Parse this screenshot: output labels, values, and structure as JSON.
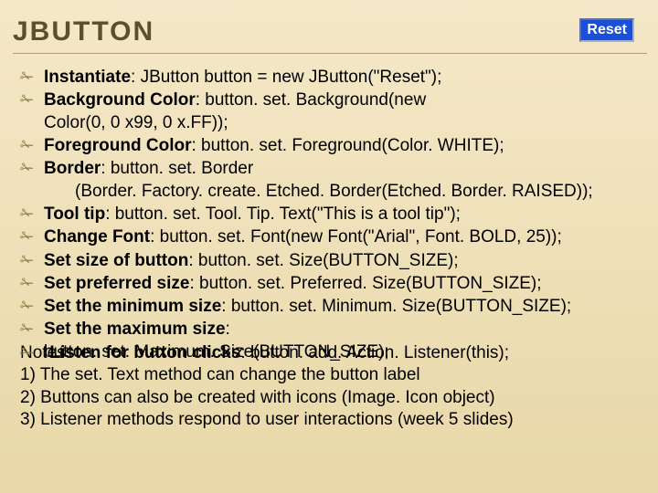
{
  "title": "JBUTTON",
  "button_label": "Reset",
  "items": [
    {
      "label": "Instantiate",
      "code": ": JButton button = new JButton(\"Reset\");"
    },
    {
      "label": "Background Color",
      "code": ": button. set. Background(new"
    },
    {
      "label_cont": "Color(0, 0 x99, 0 x.FF));"
    },
    {
      "label": "Foreground Color",
      "code": ": button. set. Foreground(Color. WHITE);"
    },
    {
      "label": "Border",
      "code": ": button. set. Border"
    },
    {
      "sub": "(Border. Factory. create. Etched. Border(Etched. Border. RAISED));"
    },
    {
      "label": "Tool tip",
      "code": ": button. set. Tool. Tip. Text(\"This is a tool tip\");"
    },
    {
      "label": "Change Font",
      "code": ": button. set. Font(new Font(\"Arial\", Font. BOLD, 25));"
    },
    {
      "label": "Set size of button",
      "code": ": button. set. Size(BUTTON_SIZE);"
    },
    {
      "label": "Set preferred size",
      "code": ": button. set. Preferred. Size(BUTTON_SIZE);"
    },
    {
      "label": "Set the minimum size",
      "code": ":  button. set. Minimum. Size(BUTTON_SIZE);"
    },
    {
      "label": "Set the maximum size",
      "code": ":"
    },
    {
      "cont": "button. set. Maximum. Size(BUTTON_SIZE);"
    }
  ],
  "overlap": {
    "label": "Listen for button clicks",
    "code": ":  button. add. Action. Listener(this);"
  },
  "notes_label": "Notes:",
  "notes": [
    "1)  The set. Text method can change the button label",
    "2)  Buttons can also be created with icons (Image. Icon object)",
    "3)  Listener methods respond to user interactions (week 5 slides)"
  ]
}
